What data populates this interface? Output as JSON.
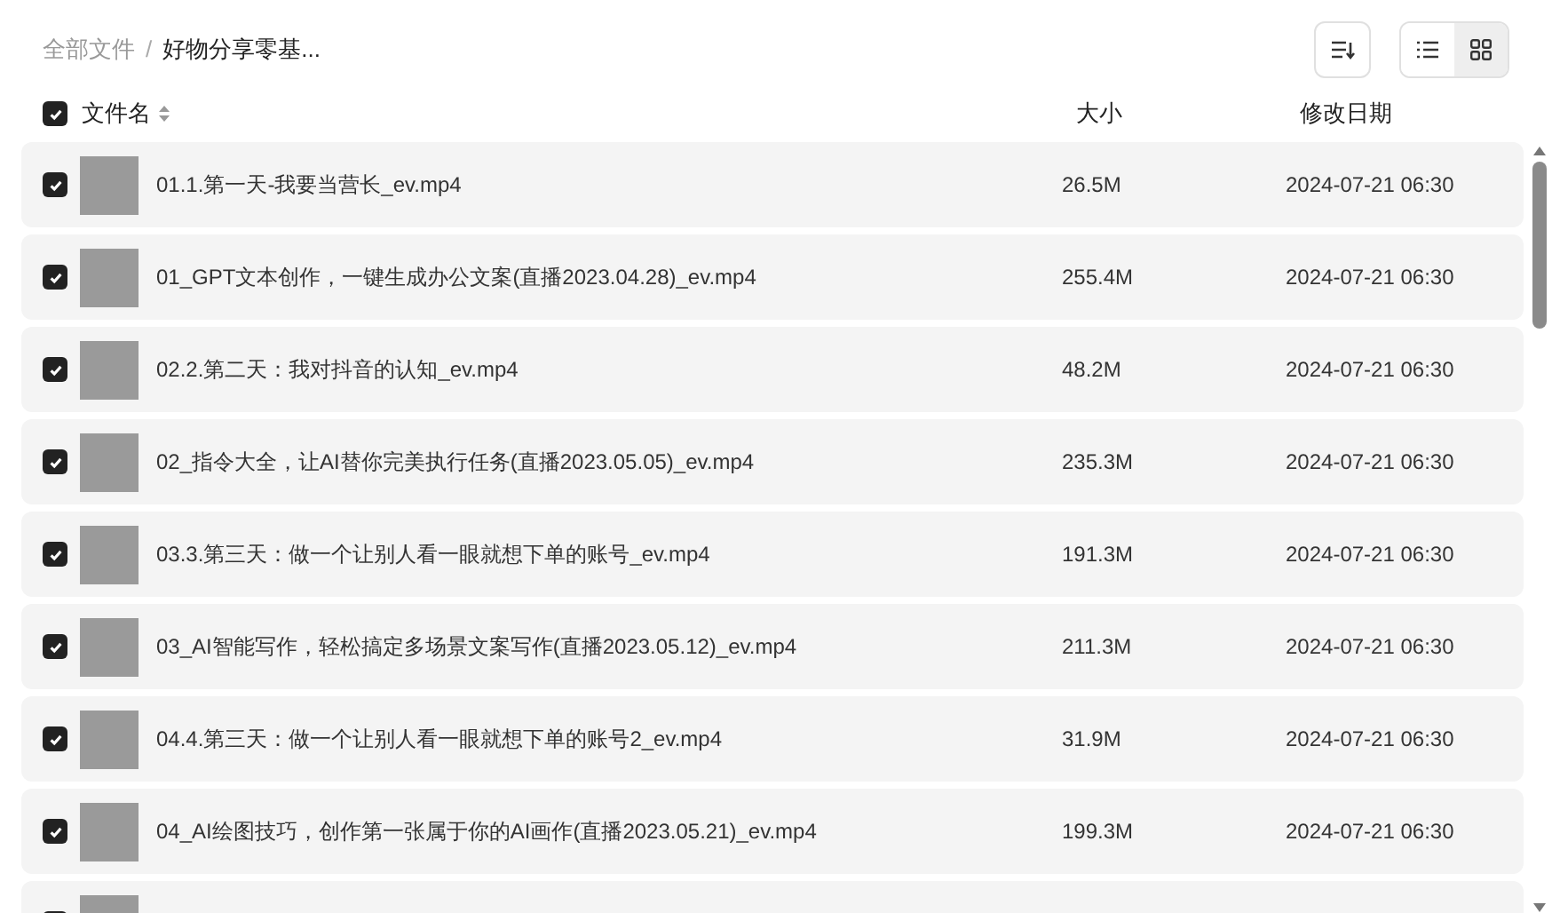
{
  "breadcrumb": {
    "separator": "/",
    "items": [
      {
        "label": "全部文件",
        "current": false
      },
      {
        "label": "好物分享零基...",
        "current": true
      }
    ]
  },
  "view_toggle": [
    {
      "kind": "list",
      "selected": false
    },
    {
      "kind": "grid",
      "selected": true
    }
  ],
  "header": {
    "checked": true,
    "columns": [
      "文件名",
      "大小",
      "修改日期"
    ]
  },
  "rows": [
    {
      "checked": true,
      "name": "01.1.第一天-我要当营长_ev.mp4",
      "size": "26.5M",
      "date": "2024-07-21 06:30"
    },
    {
      "checked": true,
      "name": "01_GPT文本创作，一键生成办公文案(直播2023.04.28)_ev.mp4",
      "size": "255.4M",
      "date": "2024-07-21 06:30"
    },
    {
      "checked": true,
      "name": "02.2.第二天：我对抖音的认知_ev.mp4",
      "size": "48.2M",
      "date": "2024-07-21 06:30"
    },
    {
      "checked": true,
      "name": "02_指令大全，让AI替你完美执行任务(直播2023.05.05)_ev.mp4",
      "size": "235.3M",
      "date": "2024-07-21 06:30"
    },
    {
      "checked": true,
      "name": "03.3.第三天：做一个让别人看一眼就想下单的账号_ev.mp4",
      "size": "191.3M",
      "date": "2024-07-21 06:30"
    },
    {
      "checked": true,
      "name": "03_AI智能写作，轻松搞定多场景文案写作(直播2023.05.12)_ev.mp4",
      "size": "211.3M",
      "date": "2024-07-21 06:30"
    },
    {
      "checked": true,
      "name": "04.4.第三天：做一个让别人看一眼就想下单的账号2_ev.mp4",
      "size": "31.9M",
      "date": "2024-07-21 06:30"
    },
    {
      "checked": true,
      "name": "04_AI绘图技巧，创作第一张属于你的AI画作(直播2023.05.21)_ev.mp4",
      "size": "199.3M",
      "date": "2024-07-21 06:30"
    },
    {
      "checked": true
    }
  ]
}
